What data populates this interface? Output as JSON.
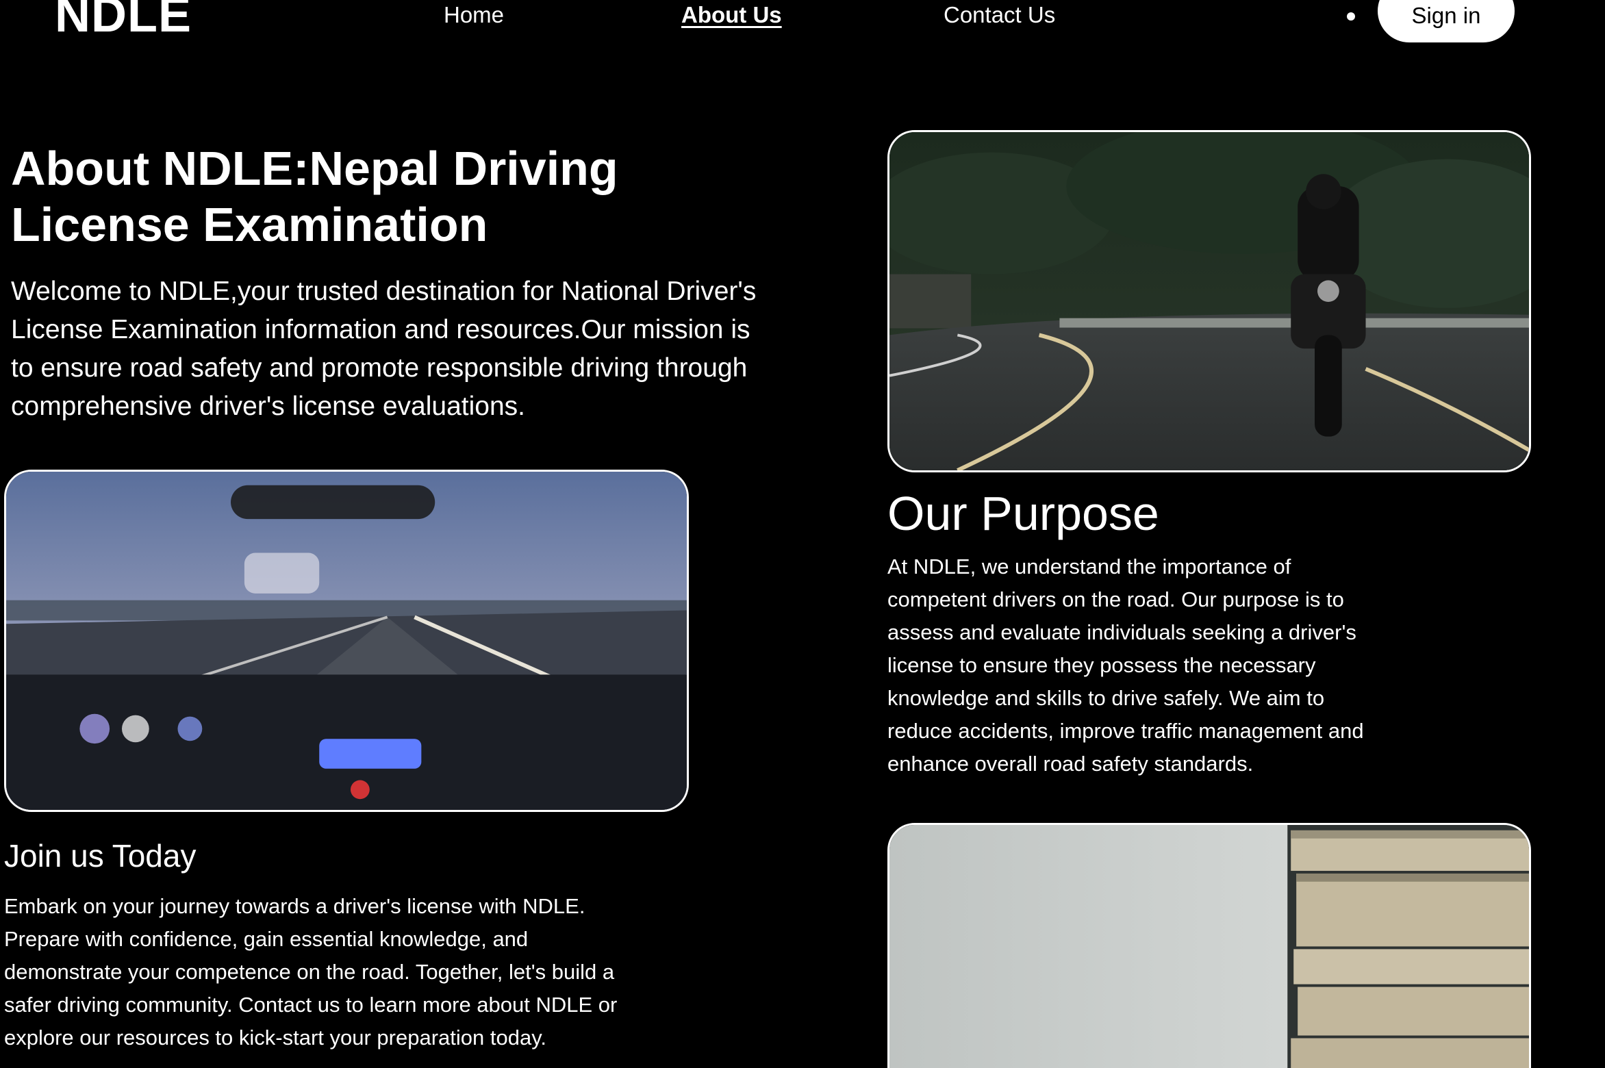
{
  "nav": {
    "logo": "NDLE",
    "links": [
      {
        "label": "Home",
        "active": false
      },
      {
        "label": "About Us",
        "active": true
      },
      {
        "label": "Contact Us",
        "active": false
      }
    ],
    "signin_label": "Sign in"
  },
  "hero": {
    "title": "About NDLE:Nepal Driving License Examination",
    "text": "Welcome to NDLE,your trusted destination for National Driver's License Examination information and resources.Our mission is to ensure road safety and promote responsible driving through comprehensive driver's license evaluations."
  },
  "purpose": {
    "title": "Our Purpose",
    "text": "At NDLE, we understand the importance of competent drivers on the road. Our purpose is to assess and evaluate individuals seeking a driver's license to ensure they possess the necessary knowledge and skills to drive safely. We aim to reduce accidents, improve traffic management and enhance overall road safety standards."
  },
  "join": {
    "title": "Join us Today",
    "text": "Embark on your journey towards a driver's license with NDLE. Prepare with confidence, gain essential knowledge, and demonstrate your competence on the road. Together, let's build a safer driving community. Contact us to learn more about NDLE or explore our resources to kick-start your preparation today."
  },
  "images": {
    "moto": "motorcycle-rider-road-photo",
    "car": "car-dashboard-highway-photo",
    "books": "stacked-books-photo"
  }
}
